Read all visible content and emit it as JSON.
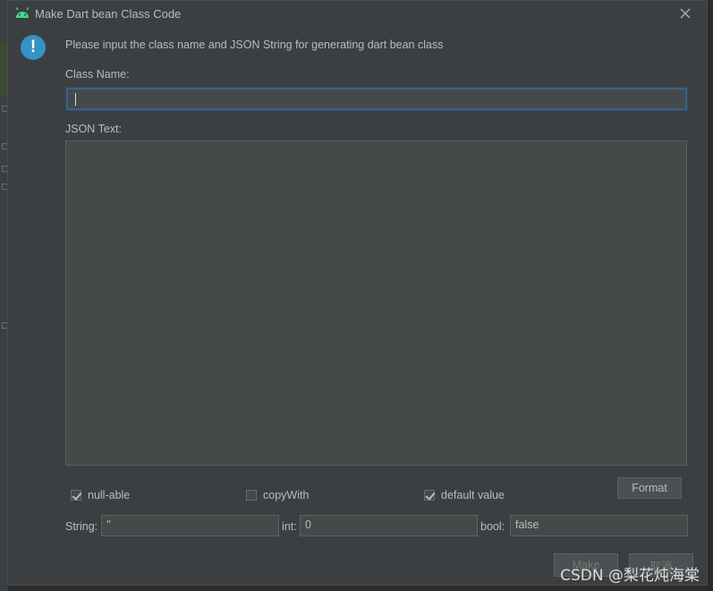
{
  "title": "Make Dart bean Class Code",
  "message": "Please input the class name and JSON String for generating dart bean class",
  "class_name": {
    "label": "Class Name:",
    "value": ""
  },
  "json_text": {
    "label": "JSON Text:",
    "value": ""
  },
  "options": {
    "null_able": {
      "label": "null-able",
      "checked": true
    },
    "copy_with": {
      "label": "copyWith",
      "checked": false
    },
    "default_value": {
      "label": "default value",
      "checked": true
    }
  },
  "format_label": "Format",
  "defaults": {
    "string_label": "String:",
    "string_value": "''",
    "int_label": "int:",
    "int_value": "0",
    "bool_label": "bool:",
    "bool_value": "false"
  },
  "buttons": {
    "make": "Make",
    "cancel": "取消"
  },
  "watermark": "CSDN @梨花炖海棠",
  "colors": {
    "dialog_bg": "#3c3f41",
    "input_bg": "#45494a",
    "text": "#bbbbbb",
    "focus_border": "#3d6185",
    "info_icon": "#3592c4",
    "android_green": "#3ddc84"
  }
}
